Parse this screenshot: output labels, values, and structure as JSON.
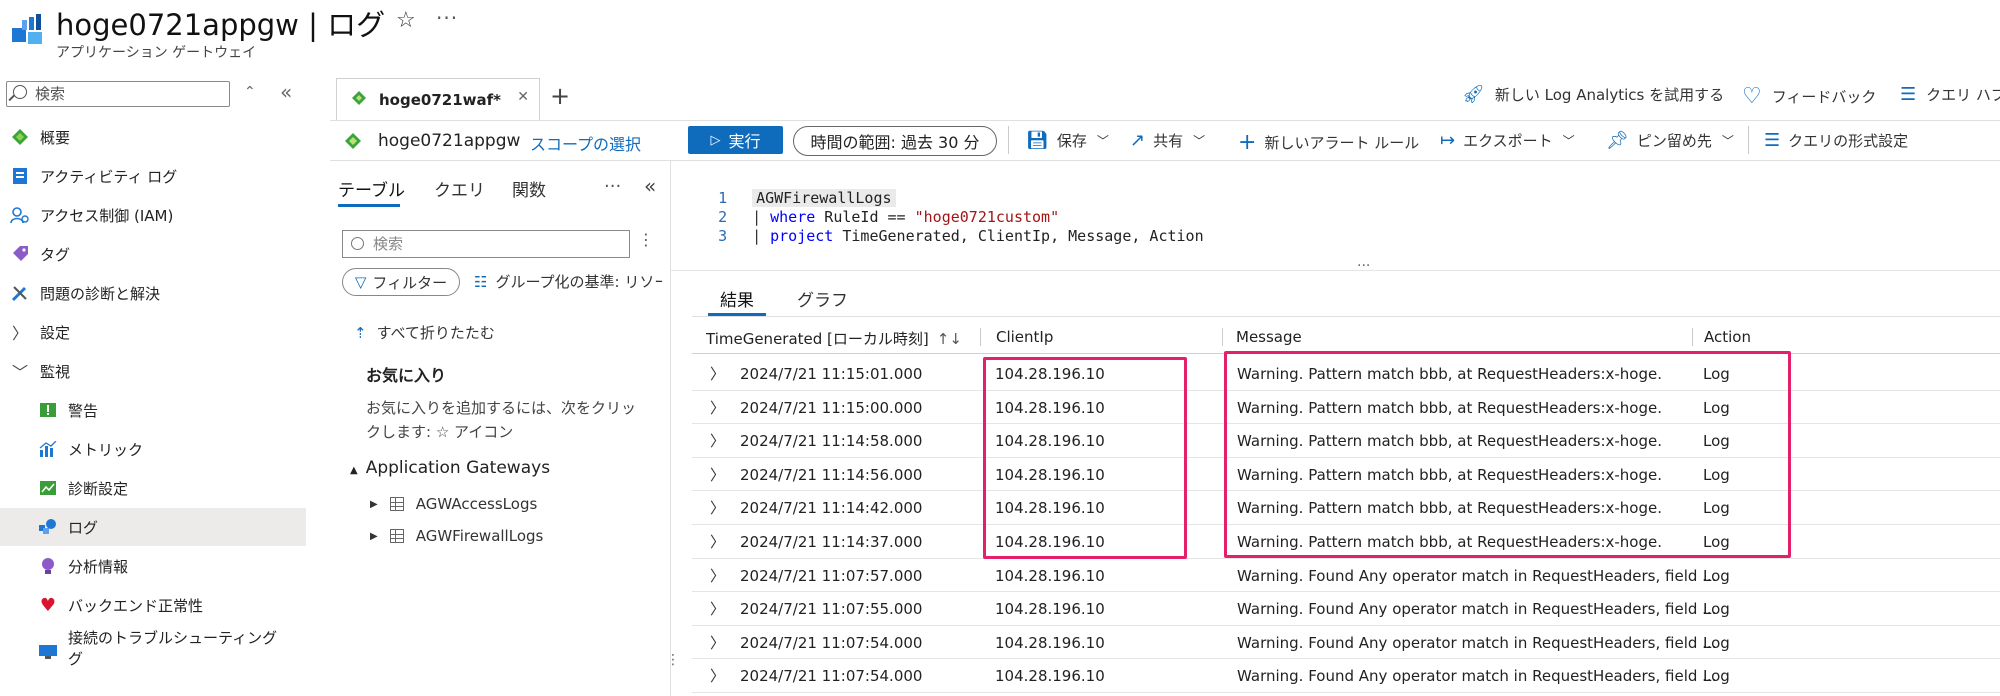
{
  "header": {
    "title": "hoge0721appgw | ログ",
    "subtitle": "アプリケーション ゲートウェイ"
  },
  "nav": {
    "search_placeholder": "検索",
    "items": [
      {
        "label": "概要",
        "icon": "overview-icon"
      },
      {
        "label": "アクティビティ ログ",
        "icon": "activity-log-icon"
      },
      {
        "label": "アクセス制御 (IAM)",
        "icon": "iam-icon"
      },
      {
        "label": "タグ",
        "icon": "tag-icon"
      },
      {
        "label": "問題の診断と解決",
        "icon": "wrench-icon"
      },
      {
        "label": "設定",
        "icon": "chevron-right-icon"
      },
      {
        "label": "監視",
        "icon": "chevron-down-icon"
      },
      {
        "label": "警告",
        "icon": "alert-icon"
      },
      {
        "label": "メトリック",
        "icon": "metrics-icon"
      },
      {
        "label": "診断設定",
        "icon": "diagnostic-settings-icon"
      },
      {
        "label": "ログ",
        "icon": "logs-icon"
      },
      {
        "label": "分析情報",
        "icon": "insights-icon"
      },
      {
        "label": "バックエンド正常性",
        "icon": "heart-icon"
      },
      {
        "label": "接続のトラブルシューティング",
        "label_line2": "グ",
        "icon": "troubleshoot-icon"
      }
    ]
  },
  "tabs": {
    "active_label": "hoge0721waf*",
    "new_log_analytics": "新しい Log Analytics を試用する",
    "feedback": "フィードバック",
    "query_hub": "クエリ ハブ"
  },
  "toolbar": {
    "scope_name": "hoge0721appgw",
    "scope_select": "スコープの選択",
    "run": "実行",
    "time_range_label": "時間の範囲:",
    "time_range_value": "過去 30 分",
    "save": "保存",
    "share": "共有",
    "new_alert": "新しいアラート ルール",
    "export": "エクスポート",
    "pin": "ピン留め先",
    "format": "クエリの形式設定"
  },
  "left_pane": {
    "tabs": [
      "テーブル",
      "クエリ",
      "関数"
    ],
    "search_placeholder": "検索",
    "filter": "フィルター",
    "group_by": "グループ化の基準: リソース",
    "collapse_all": "すべて折りたたむ",
    "favorites_title": "お気に入り",
    "favorites_desc": "お気に入りを追加するには、次をクリックします: ☆ アイコン",
    "section": "Application Gateways",
    "tables": [
      "AGWAccessLogs",
      "AGWFirewallLogs"
    ]
  },
  "editor": {
    "line_numbers": [
      "1",
      "2",
      "3"
    ],
    "line1": "AGWFirewallLogs",
    "line2_kw": "where",
    "line2_mid": " RuleId == ",
    "line2_str": "\"hoge0721custom\"",
    "line3_kw": "project",
    "line3_rest": " TimeGenerated, ClientIp, Message, Action"
  },
  "results": {
    "tabs": [
      "結果",
      "グラフ"
    ],
    "columns": [
      "TimeGenerated [ローカル時刻]",
      "ClientIp",
      "Message",
      "Action"
    ],
    "rows": [
      [
        "2024/7/21 11:15:01.000",
        "104.28.196.10",
        "Warning. Pattern match bbb, at RequestHeaders:x-hoge.",
        "Log"
      ],
      [
        "2024/7/21 11:15:00.000",
        "104.28.196.10",
        "Warning. Pattern match bbb, at RequestHeaders:x-hoge.",
        "Log"
      ],
      [
        "2024/7/21 11:14:58.000",
        "104.28.196.10",
        "Warning. Pattern match bbb, at RequestHeaders:x-hoge.",
        "Log"
      ],
      [
        "2024/7/21 11:14:56.000",
        "104.28.196.10",
        "Warning. Pattern match bbb, at RequestHeaders:x-hoge.",
        "Log"
      ],
      [
        "2024/7/21 11:14:42.000",
        "104.28.196.10",
        "Warning. Pattern match bbb, at RequestHeaders:x-hoge.",
        "Log"
      ],
      [
        "2024/7/21 11:14:37.000",
        "104.28.196.10",
        "Warning. Pattern match bbb, at RequestHeaders:x-hoge.",
        "Log"
      ],
      [
        "2024/7/21 11:07:57.000",
        "104.28.196.10",
        "Warning. Found Any operator match in RequestHeaders, field ...",
        "Log"
      ],
      [
        "2024/7/21 11:07:55.000",
        "104.28.196.10",
        "Warning. Found Any operator match in RequestHeaders, field ...",
        "Log"
      ],
      [
        "2024/7/21 11:07:54.000",
        "104.28.196.10",
        "Warning. Found Any operator match in RequestHeaders, field ...",
        "Log"
      ],
      [
        "2024/7/21 11:07:54.000",
        "104.28.196.10",
        "Warning. Found Any operator match in RequestHeaders, field ...",
        "Log"
      ]
    ]
  },
  "colors": {
    "accent": "#0f6cbd",
    "highlight": "#e5206b"
  }
}
